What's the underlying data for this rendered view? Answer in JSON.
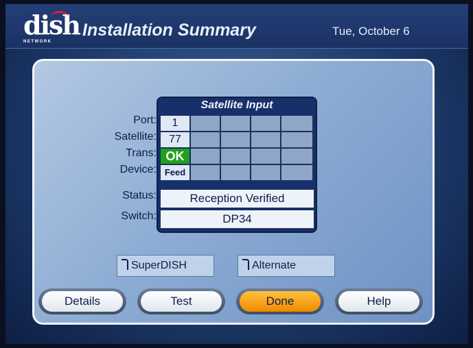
{
  "brand": {
    "logo_text": "dish",
    "logo_sub": "NETWORK"
  },
  "header": {
    "title": "Installation Summary",
    "date": "Tue, October 6"
  },
  "grid": {
    "title": "Satellite Input",
    "row_labels": [
      "Port:",
      "Satellite:",
      "Trans:",
      "Device:"
    ],
    "first_col": [
      "1",
      "77",
      "OK",
      "Feed"
    ],
    "status_label": "Status:",
    "status_value": "Reception Verified",
    "switch_label": "Switch:",
    "switch_value": "DP34"
  },
  "options": {
    "superdish": "SuperDISH",
    "alternate": "Alternate"
  },
  "buttons": {
    "details": "Details",
    "test": "Test",
    "done": "Done",
    "help": "Help"
  },
  "colors": {
    "ok_green": "#21a01f",
    "selected_orange": "#f08a00",
    "logo_red": "#e3202a"
  }
}
